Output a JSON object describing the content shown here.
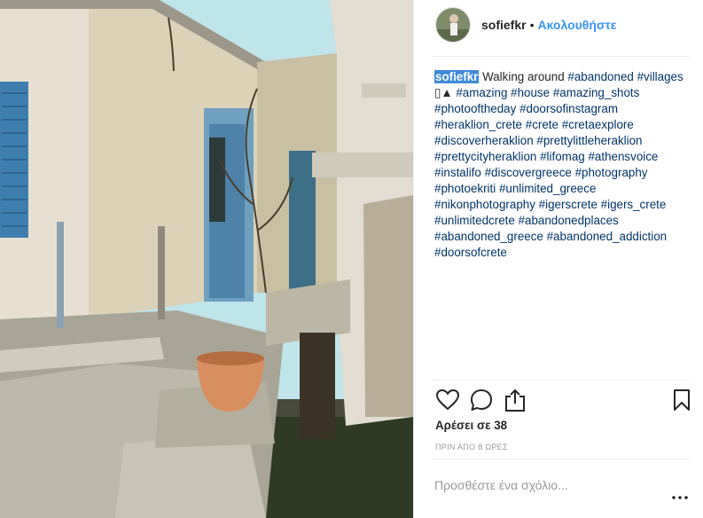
{
  "post": {
    "username": "sofiefkr",
    "separator": "•",
    "follow_label": "Ακολουθήστε",
    "caption_user": "sofiefkr",
    "caption_text": " Walking around ",
    "caption_symbols": " ▯▲ ",
    "hashtags": [
      "#abandoned",
      "#villages",
      "#amazing",
      "#house",
      "#amazing_shots",
      "#photooftheday",
      "#doorsofinstagram",
      "#heraklion_crete",
      "#crete",
      "#cretaexplore",
      "#discoverheraklion",
      "#prettylittleheraklion",
      "#prettycityheraklion",
      "#lifomag",
      "#athensvoice",
      "#instalifo",
      "#discovergreece",
      "#photography",
      "#photoekriti",
      "#unlimited_greece",
      "#nikonphotography",
      "#igerscrete",
      "#igers_crete",
      "#unlimitedcrete",
      "#abandonedplaces",
      "#abandoned_greece",
      "#abandoned_addiction",
      "#doorsofcrete"
    ],
    "likes_label": "Αρέσει σε 38",
    "time_label": "ΠΡΙΝ ΑΠΟ 8 ΩΡΕΣ",
    "comment_placeholder": "Προσθέστε ένα σχόλιο...",
    "more_label": "•••"
  },
  "icons": {
    "like": "heart-icon",
    "comment": "speech-bubble-icon",
    "share": "share-icon",
    "save": "bookmark-icon",
    "more": "more-options-icon"
  },
  "colors": {
    "follow": "#3897f0",
    "hashtag": "#003569",
    "highlight": "#3f8ad8",
    "shutter_blue": "#3f7fb0"
  }
}
